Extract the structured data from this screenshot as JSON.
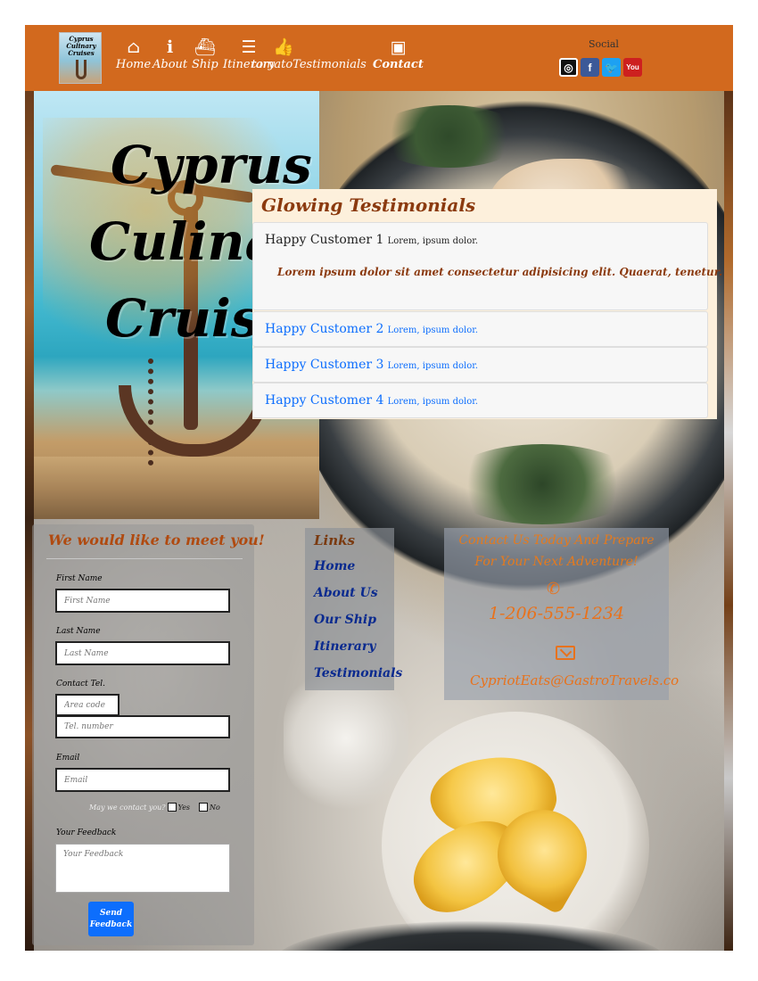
{
  "nav": {
    "logo_text": [
      "Cyprus",
      "Culinary",
      "Cruises"
    ],
    "items": [
      {
        "label": "Home",
        "icon": "home-icon",
        "glyph": "⌂"
      },
      {
        "label": "About",
        "icon": "info-icon",
        "glyph": "ℹ"
      },
      {
        "label": "Ship",
        "icon": "ship-icon",
        "glyph": "⛴"
      },
      {
        "label": "Itinerary",
        "icon": "list-icon",
        "glyph": "☰"
      },
      {
        "label": "tomatoTestimonials",
        "icon": "thumbs-up-icon",
        "glyph": "👍"
      },
      {
        "label": "Contact",
        "icon": "contact-card-icon",
        "glyph": "▣"
      }
    ],
    "social_label": "Social",
    "social": [
      {
        "name": "instagram-icon",
        "glyph": "◎"
      },
      {
        "name": "facebook-icon",
        "glyph": "f"
      },
      {
        "name": "twitter-icon",
        "glyph": "🐦"
      },
      {
        "name": "youtube-icon",
        "glyph": "You"
      }
    ]
  },
  "hero": {
    "title_lines": [
      "Cyprus",
      "Culinary",
      "Cruises"
    ]
  },
  "testimonials": {
    "heading": "Glowing Testimonials",
    "items": [
      {
        "name": "Happy Customer 1",
        "summary": "Lorem, ipsum dolor.",
        "body": "Lorem ipsum dolor sit amet consectetur adipisicing elit. Quaerat, tenetur.",
        "expanded": true
      },
      {
        "name": "Happy Customer 2",
        "summary": "Lorem, ipsum dolor.",
        "expanded": false
      },
      {
        "name": "Happy Customer 3",
        "summary": "Lorem, ipsum dolor.",
        "expanded": false
      },
      {
        "name": "Happy Customer 4",
        "summary": "Lorem, ipsum dolor.",
        "expanded": false
      }
    ]
  },
  "form": {
    "heading": "We would like to meet you!",
    "first_name_label": "First Name",
    "first_name_placeholder": "First Name",
    "last_name_label": "Last Name",
    "last_name_placeholder": "Last Name",
    "tel_label": "Contact Tel.",
    "area_code_placeholder": "Area code",
    "tel_number_placeholder": "Tel. number",
    "email_label": "Email",
    "email_placeholder": "Email",
    "consent_question": "May we contact you?",
    "consent_yes": "Yes",
    "consent_no": "No",
    "feedback_label": "Your Feedback",
    "feedback_placeholder": "Your Feedback",
    "send_button_line1": "Send",
    "send_button_line2": "Feedback"
  },
  "links": {
    "title": "Links",
    "items": [
      "Home",
      "About Us",
      "Our Ship",
      "Itinerary",
      "Testimonials"
    ]
  },
  "contact": {
    "title_line1": "Contact Us Today And Prepare",
    "title_line2": "For Your Next Adventure!",
    "phone": "1-206-555-1234",
    "email": "CypriotEats@GastroTravels.co"
  },
  "colors": {
    "navbar": "#d2691e",
    "accent_orange": "#e8721c",
    "heading_brown": "#8b3a0f",
    "link_blue": "#0d6efd"
  }
}
